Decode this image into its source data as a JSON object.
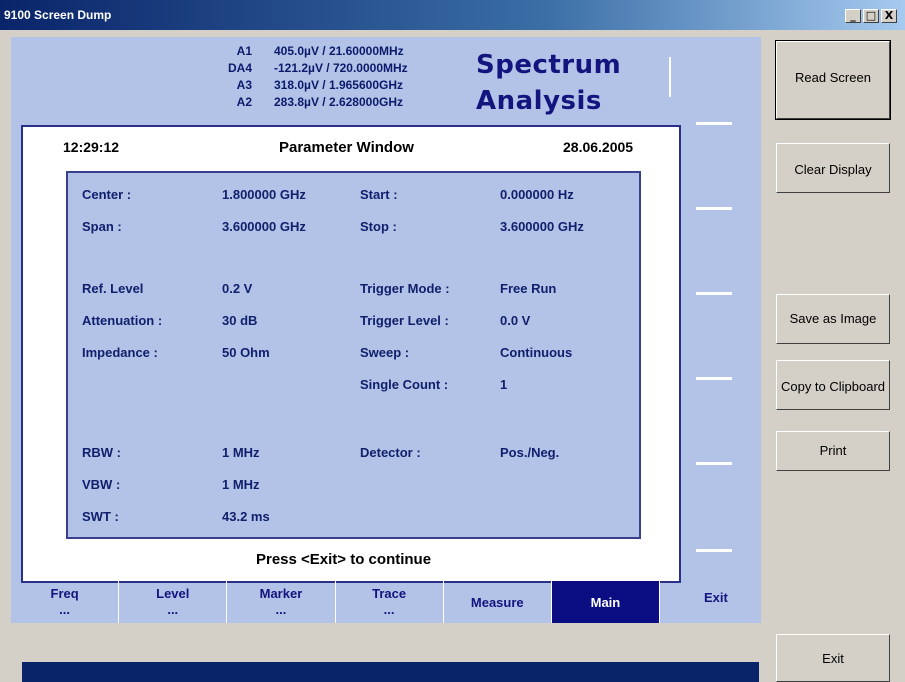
{
  "window": {
    "title": "9100 Screen Dump",
    "controls": [
      "_",
      "□",
      "X"
    ]
  },
  "markers": [
    {
      "name": "A1",
      "value": "405.0µV / 21.60000MHz"
    },
    {
      "name": "DA4",
      "value": "-121.2µV / 720.0000MHz"
    },
    {
      "name": "A3",
      "value": "318.0µV / 1.965600GHz"
    },
    {
      "name": "A2",
      "value": "283.8µV / 2.628000GHz"
    }
  ],
  "headline": {
    "line1": "Spectrum",
    "line2": "Analysis"
  },
  "dialog": {
    "time": "12:29:12",
    "title": "Parameter Window",
    "date": "28.06.2005",
    "press_hint": "Press <Exit> to continue",
    "params": {
      "center": {
        "label": "Center :",
        "value": "1.800000 GHz"
      },
      "start": {
        "label": "Start :",
        "value": "0.000000 Hz"
      },
      "span": {
        "label": "Span :",
        "value": "3.600000 GHz"
      },
      "stop": {
        "label": "Stop :",
        "value": "3.600000 GHz"
      },
      "ref_level": {
        "label": "Ref. Level",
        "value": "0.2 V"
      },
      "trigger_mode": {
        "label": "Trigger Mode :",
        "value": "Free Run"
      },
      "attenuation": {
        "label": "Attenuation :",
        "value": "30 dB"
      },
      "trigger_level": {
        "label": "Trigger Level :",
        "value": "0.0 V"
      },
      "impedance": {
        "label": "Impedance :",
        "value": "50 Ohm"
      },
      "sweep": {
        "label": "Sweep :",
        "value": "Continuous"
      },
      "single_count": {
        "label": "Single Count :",
        "value": "1"
      },
      "rbw": {
        "label": "RBW :",
        "value": "1 MHz"
      },
      "detector": {
        "label": "Detector :",
        "value": "Pos./Neg."
      },
      "vbw": {
        "label": "VBW :",
        "value": "1 MHz"
      },
      "swt": {
        "label": "SWT :",
        "value": "43.2 ms"
      }
    }
  },
  "softkeys": {
    "tabs": [
      {
        "label": "Freq",
        "sub": "..."
      },
      {
        "label": "Level",
        "sub": "..."
      },
      {
        "label": "Marker",
        "sub": "..."
      },
      {
        "label": "Trace",
        "sub": "..."
      },
      {
        "label": "Measure",
        "sub": ""
      },
      {
        "label": "Main",
        "sub": ""
      }
    ],
    "exit": "Exit"
  },
  "side_buttons": {
    "read_screen": "Read Screen",
    "clear_display": "Clear Display",
    "save_as_image": "Save as Image",
    "copy_to_clipboard": "Copy to Clipboard",
    "print": "Print",
    "exit": "Exit"
  },
  "colors": {
    "screen_bg": "#b3c3e7",
    "accent": "#0b0e82",
    "title_bar": "#0a246a"
  }
}
